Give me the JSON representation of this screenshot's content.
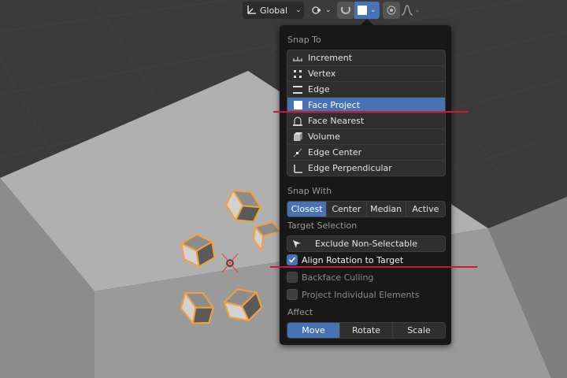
{
  "header": {
    "orientation_label": "Global",
    "icons": {
      "transform_orientation": "axes-icon",
      "pivot": "link-icon",
      "snap_toggle": "magnet-icon",
      "snap_target": "face-icon",
      "proportional_edit": "circle-icon",
      "falloff": "falloff-curve-icon"
    }
  },
  "popup": {
    "snap_to_label": "Snap To",
    "snap_to_items": [
      {
        "label": "Increment",
        "icon": "increment-icon",
        "selected": false
      },
      {
        "label": "Vertex",
        "icon": "vertex-icon",
        "selected": false
      },
      {
        "label": "Edge",
        "icon": "edge-icon",
        "selected": false
      },
      {
        "label": "Face Project",
        "icon": "face-project-icon",
        "selected": true
      },
      {
        "label": "Face Nearest",
        "icon": "face-nearest-icon",
        "selected": false
      },
      {
        "label": "Volume",
        "icon": "volume-icon",
        "selected": false
      },
      {
        "label": "Edge Center",
        "icon": "edge-center-icon",
        "selected": false
      },
      {
        "label": "Edge Perpendicular",
        "icon": "edge-perpendicular-icon",
        "selected": false
      }
    ],
    "snap_with_label": "Snap With",
    "snap_with_options": [
      {
        "label": "Closest",
        "selected": true
      },
      {
        "label": "Center",
        "selected": false
      },
      {
        "label": "Median",
        "selected": false
      },
      {
        "label": "Active",
        "selected": false
      }
    ],
    "target_selection_label": "Target Selection",
    "exclude_button_label": "Exclude Non-Selectable",
    "checkboxes": [
      {
        "label": "Align Rotation to Target",
        "checked": true
      },
      {
        "label": "Backface Culling",
        "checked": false
      },
      {
        "label": "Project Individual Elements",
        "checked": false
      }
    ],
    "affect_label": "Affect",
    "affect_options": [
      {
        "label": "Move",
        "selected": true
      },
      {
        "label": "Rotate",
        "selected": false
      },
      {
        "label": "Scale",
        "selected": false
      }
    ]
  },
  "colors": {
    "accent": "#4772b3",
    "popup_bg": "#181818",
    "viewport_bg": "#3b3b3b",
    "object_surface": "#aaaaaa",
    "selection_outline": "#f5a03a",
    "annotation_line": "#d0163b"
  }
}
